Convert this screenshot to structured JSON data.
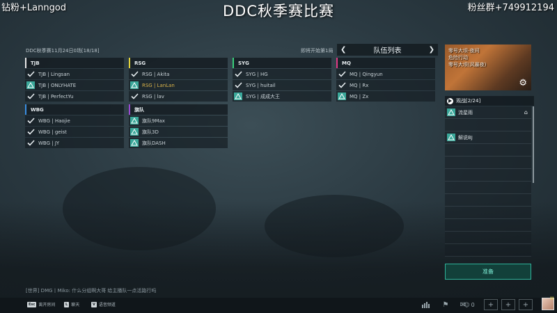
{
  "overlay": {
    "top_left": "钻粉+Lanngod",
    "top_right": "粉丝群+749912194",
    "title": "DDC秋季赛比赛"
  },
  "match": {
    "info": "DDC秋季赛11月24日0场[18/18]",
    "queue_status": "即将开始第1局"
  },
  "team_list": {
    "title": "队伍列表"
  },
  "teams": [
    {
      "name": "TJB",
      "players": [
        {
          "name": "TJB | Lingsan",
          "status": "ready"
        },
        {
          "name": "TJB | ONLYHATE",
          "status": "not-ready"
        },
        {
          "name": "TJB | PerfectYu",
          "status": "ready"
        }
      ]
    },
    {
      "name": "RSG",
      "players": [
        {
          "name": "RSG | Akita",
          "status": "ready"
        },
        {
          "name": "RSG | LanLan",
          "status": "not-ready"
        },
        {
          "name": "RSG | lav",
          "status": "ready"
        }
      ]
    },
    {
      "name": "SYG",
      "players": [
        {
          "name": "SYG | HG",
          "status": "ready"
        },
        {
          "name": "SYG | huitail",
          "status": "ready"
        },
        {
          "name": "SYG | 成成大王",
          "status": "not-ready"
        }
      ]
    },
    {
      "name": "MQ",
      "players": [
        {
          "name": "MQ | Qingyun",
          "status": "ready"
        },
        {
          "name": "MQ | Rx",
          "status": "ready"
        },
        {
          "name": "MQ | Zx",
          "status": "not-ready"
        }
      ]
    },
    {
      "name": "WBG",
      "players": [
        {
          "name": "WBG | Haojie",
          "status": "ready"
        },
        {
          "name": "WBG | geist",
          "status": "ready"
        },
        {
          "name": "WBG | JY",
          "status": "ready"
        }
      ]
    },
    {
      "name": "旗队",
      "players": [
        {
          "name": "旗队9Max",
          "status": "not-ready"
        },
        {
          "name": "旗队3D",
          "status": "not-ready"
        },
        {
          "name": "旗队DASH",
          "status": "not-ready"
        }
      ]
    }
  ],
  "card": {
    "line1": "零号大坝-夜间",
    "line2": "危险行动",
    "line3": "零号大坝(风暴夜)"
  },
  "spectate": {
    "title": "观战[2/24]",
    "rows": [
      "流星雨",
      "",
      "解说BJ",
      "",
      "",
      "",
      "",
      "",
      "",
      "",
      "",
      ""
    ]
  },
  "ready_button": {
    "label": "准备"
  },
  "chat": {
    "line": "[世界] DMG丨Miko: 什么分组啊大哥 给主播队一点活路行吗"
  },
  "bottom_bar": {
    "hints": [
      {
        "key": "Esc",
        "label": "离开房间"
      },
      {
        "key": "L",
        "label": "聊天"
      },
      {
        "key": "V",
        "label": "语音频道"
      }
    ],
    "friend_count": "0"
  },
  "colors": {
    "accent": "#2fb39a",
    "tjb": "#e8e8e8",
    "rsg": "#e2d23a",
    "syg": "#3ad07a",
    "mq": "#e23a86",
    "wbg": "#3a8ee2",
    "flag_team": "#9a4ad2"
  }
}
